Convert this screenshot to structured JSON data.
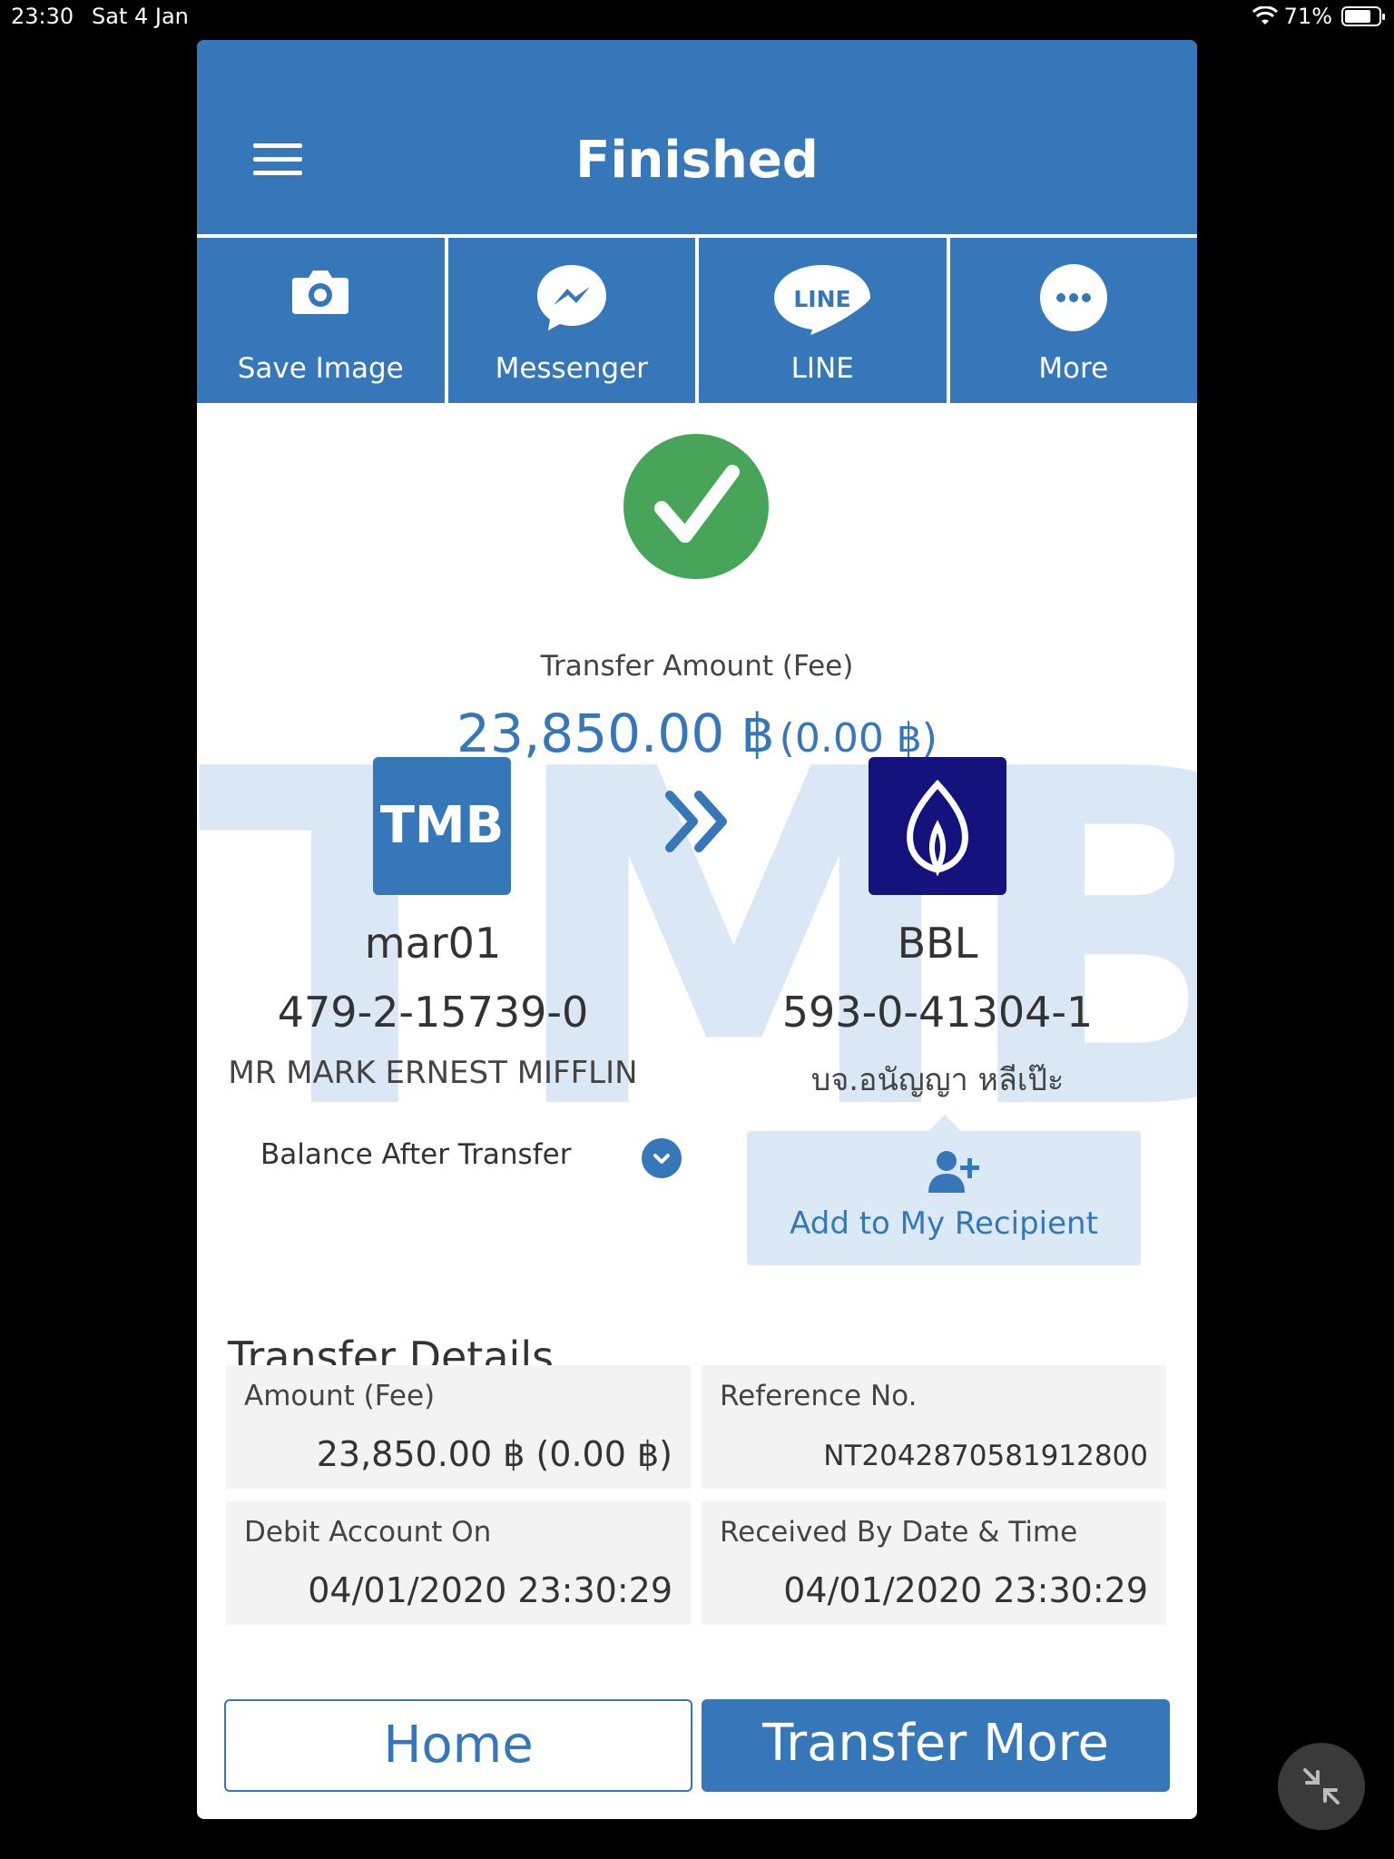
{
  "status_bar": {
    "time": "23:30",
    "date": "Sat 4 Jan",
    "battery": "71%"
  },
  "header": {
    "title": "Finished"
  },
  "share": [
    {
      "label": "Save Image",
      "icon": "camera-icon"
    },
    {
      "label": "Messenger",
      "icon": "messenger-icon"
    },
    {
      "label": "LINE",
      "icon": "line-icon",
      "icon_text": "LINE"
    },
    {
      "label": "More",
      "icon": "more-icon"
    }
  ],
  "transfer": {
    "amount_label": "Transfer Amount (Fee)",
    "amount": "23,850.00 ฿",
    "fee": "(0.00 ฿)"
  },
  "watermark": "TMB",
  "from": {
    "bank_logo_text": "TMB",
    "nickname": "mar01",
    "account": "479-2-15739-0",
    "name": "MR MARK ERNEST MIFFLIN"
  },
  "to": {
    "nickname": "BBL",
    "account": "593-0-41304-1",
    "name": "บจ.อนัญญา หลีเป๊ะ"
  },
  "balance_label": "Balance After Transfer",
  "add_recipient_label": "Add to My Recipient",
  "details": {
    "title": "Transfer Details",
    "amount_fee_label": "Amount (Fee)",
    "amount_fee_value": "23,850.00 ฿ (0.00 ฿)",
    "reference_label": "Reference No.",
    "reference_value": "NT2042870581912800",
    "debit_label": "Debit Account On",
    "debit_value": "04/01/2020 23:30:29",
    "received_label": "Received By Date & Time",
    "received_value": "04/01/2020 23:30:29"
  },
  "buttons": {
    "home": "Home",
    "transfer_more": "Transfer More"
  },
  "colors": {
    "primary": "#3577b8",
    "success": "#47a55a",
    "bbl": "#14137e",
    "watermark": "#dae8f5"
  }
}
